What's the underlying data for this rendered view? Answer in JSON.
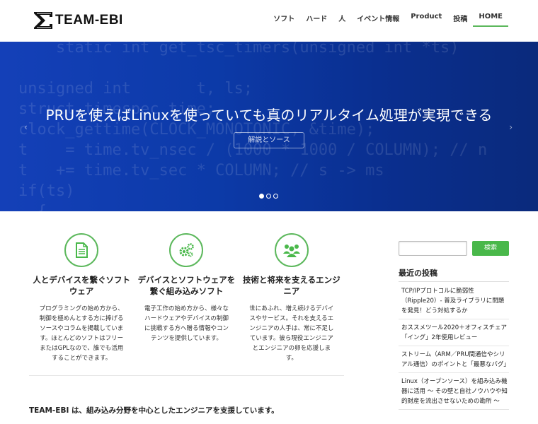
{
  "site": {
    "logo_text": "TEAM-EBI"
  },
  "nav": {
    "items": [
      {
        "label": "ソフト"
      },
      {
        "label": "ハード"
      },
      {
        "label": "人"
      },
      {
        "label": "イベント情報"
      },
      {
        "label": "Product"
      },
      {
        "label": "投稿"
      },
      {
        "label": "HOME",
        "active": true
      }
    ]
  },
  "hero": {
    "title": "PRUを使えばLinuxを使っていても真のリアルタイム処理が実現できる",
    "button_label": "解説とソース",
    "prev_icon": "chevron-left-icon",
    "next_icon": "chevron-right-icon",
    "slide_count": 3,
    "active_slide": 1
  },
  "features": [
    {
      "icon": "document-icon",
      "title": "人とデバイスを繋ぐソフトウェア",
      "text": "プログラミングの始め方から、制御を極めんとする方に捧げるソースやコラムを掲載しています。ほとんどのソフトはフリーまたはGPLなので、誰でも活用することができます。"
    },
    {
      "icon": "gears-icon",
      "title": "デバイスとソフトウェアを繋ぐ組み込みソフト",
      "text": "電子工作の始め方から、様々なハードウェアやデバイスの制御に挑戦する方へ贈る情報やコンテンツを提供しています。"
    },
    {
      "icon": "people-icon",
      "title": "技術と将来を支えるエンジニア",
      "text": "世にあふれ、増え続けるデバイスやサービス。それを支えるエンジニアの人手は、常に不足しています。彼ら現役エンジニアとエンジニアの卵を応援します。"
    }
  ],
  "tagline": "TEAM-EBI は、組み込み分野を中心としたエンジニアを支援しています。",
  "sidebar": {
    "search_placeholder": "",
    "search_button": "検索",
    "recent_heading": "最近の投稿",
    "recent_posts": [
      {
        "title": "TCP/IPプロトコルに脆弱性（Ripple20）- 普及ライブラリに問題を発見！どう対処するか"
      },
      {
        "title": "おススメツール2020＋オフィスチェア「イング」2年使用レビュー"
      },
      {
        "title": "ストリーム（ARM／PRU間通信やシリアル通信）のポイントと「最悪なバグ」"
      },
      {
        "title": "Linux（オープンソース）を組み込み機器に活用 ～ その壁と自社ノウハウや知的財産を流出させないための勘所 ～"
      }
    ]
  },
  "colors": {
    "accent": "#5cb85c",
    "button": "#49b84a",
    "hero_blue": "#0c3aa8"
  }
}
